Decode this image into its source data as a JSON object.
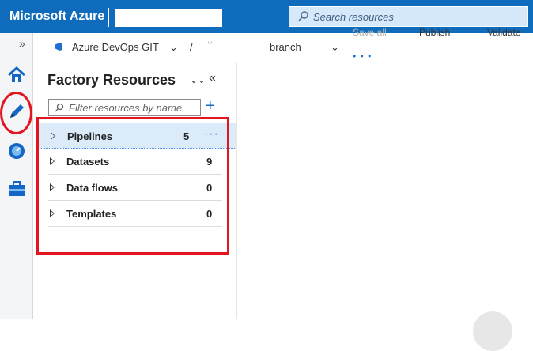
{
  "topbar": {
    "brand": "Microsoft Azure",
    "search_placeholder": "Search resources"
  },
  "toolbar": {
    "repo_label": "Azure DevOps GIT",
    "branch_label": "branch",
    "save_all_label": "Save all",
    "publish_label": "Publish",
    "validate_label": "Validate"
  },
  "rail": {
    "items": [
      {
        "name": "home-icon"
      },
      {
        "name": "author-pencil-icon"
      },
      {
        "name": "monitor-icon"
      },
      {
        "name": "manage-toolbox-icon"
      }
    ]
  },
  "panel": {
    "title": "Factory Resources",
    "filter_placeholder": "Filter resources by name",
    "items": [
      {
        "label": "Pipelines",
        "count": "5"
      },
      {
        "label": "Datasets",
        "count": "9"
      },
      {
        "label": "Data flows",
        "count": "0"
      },
      {
        "label": "Templates",
        "count": "0"
      }
    ]
  },
  "colors": {
    "accent": "#0f6cbd",
    "highlight": "#e3151f",
    "selected_row": "#dcebfa"
  }
}
